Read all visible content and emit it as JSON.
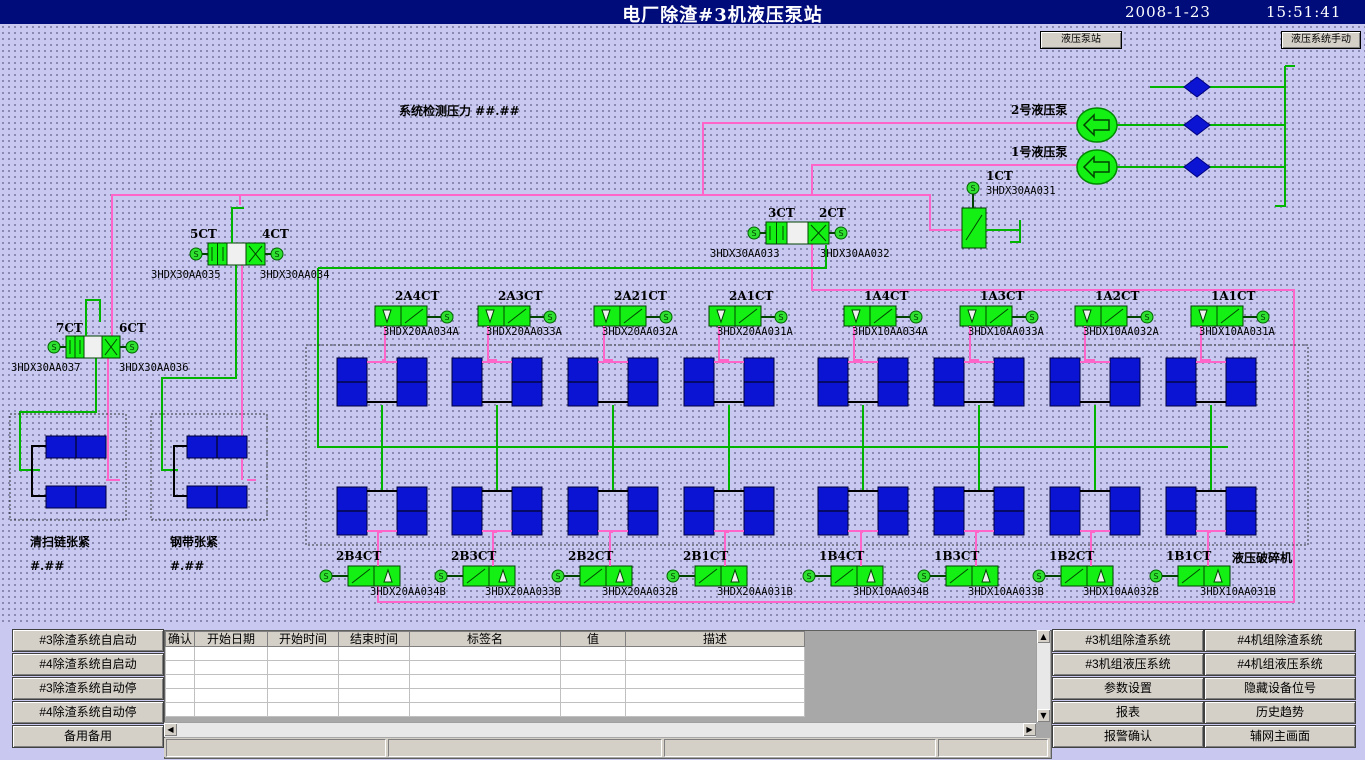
{
  "title": "电厂除渣#3机液压泵站",
  "date": "2008-1-23",
  "time": "15:51:41",
  "top_buttons": [
    "液压泵站",
    "液压系统手动"
  ],
  "pressure_label": "系统检测压力 ##.##",
  "pumps": [
    "2号液压泵",
    "1号液压泵"
  ],
  "valve_1ct": {
    "label": "1CT",
    "code": "3HDX30AA031"
  },
  "valve_pairs": [
    {
      "left": "3CT",
      "right": "2CT",
      "left_code": "3HDX30AA033",
      "right_code": "3HDX30AA032"
    },
    {
      "left": "5CT",
      "right": "4CT",
      "left_code": "3HDX30AA035",
      "right_code": "3HDX30AA034"
    },
    {
      "left": "7CT",
      "right": "6CT",
      "left_code": "3HDX30AA037",
      "right_code": "3HDX30AA036"
    }
  ],
  "upper_valves": [
    {
      "label": "2A4CT",
      "code": "3HDX20AA034A"
    },
    {
      "label": "2A3CT",
      "code": "3HDX20AA033A"
    },
    {
      "label": "2A21CT",
      "code": "3HDX20AA032A"
    },
    {
      "label": "2A1CT",
      "code": "3HDX20AA031A"
    },
    {
      "label": "1A4CT",
      "code": "3HDX10AA034A"
    },
    {
      "label": "1A3CT",
      "code": "3HDX10AA033A"
    },
    {
      "label": "1A2CT",
      "code": "3HDX10AA032A"
    },
    {
      "label": "1A1CT",
      "code": "3HDX10AA031A"
    }
  ],
  "lower_valves": [
    {
      "label": "2B4CT",
      "code": "3HDX20AA034B"
    },
    {
      "label": "2B3CT",
      "code": "3HDX20AA033B"
    },
    {
      "label": "2B2CT",
      "code": "3HDX20AA032B"
    },
    {
      "label": "2B1CT",
      "code": "3HDX20AA031B"
    },
    {
      "label": "1B4CT",
      "code": "3HDX10AA034B"
    },
    {
      "label": "1B3CT",
      "code": "3HDX10AA033B"
    },
    {
      "label": "1B2CT",
      "code": "3HDX10AA032B"
    },
    {
      "label": "1B1CT",
      "code": "3HDX10AA031B"
    }
  ],
  "crusher_label": "液压破碎机",
  "tension": [
    {
      "label": "清扫链张紧",
      "value": "#.##"
    },
    {
      "label": "钢带张紧",
      "value": "#.##"
    }
  ],
  "solenoid_letter": "S",
  "left_buttons": [
    "#3除渣系统自启动",
    "#4除渣系统自启动",
    "#3除渣系统自动停",
    "#4除渣系统自动停",
    "备用备用"
  ],
  "right_buttons": [
    [
      "#3机组除渣系统",
      "#4机组除渣系统"
    ],
    [
      "#3机组液压系统",
      "#4机组液压系统"
    ],
    [
      "参数设置",
      "隐藏设备位号"
    ],
    [
      "报表",
      "历史趋势"
    ],
    [
      "报警确认",
      "辅网主画面"
    ]
  ],
  "alarm_columns": [
    "确认",
    "开始日期",
    "开始时间",
    "结束时间",
    "标签名",
    "值",
    "描述"
  ],
  "colors": {
    "title_bg": "#000c7a",
    "oil_pink": "#ff64c8",
    "oil_green": "#00b400",
    "cylinder_blue": "#0a14d2",
    "valve_green": "#14f014"
  }
}
